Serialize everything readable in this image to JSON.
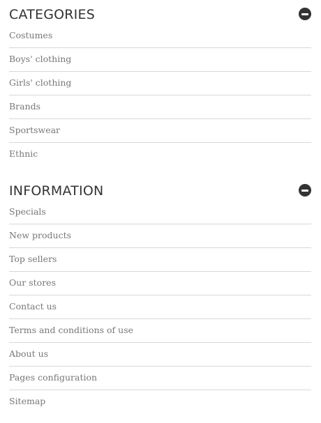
{
  "categories": {
    "title": "CATEGORIES",
    "toggle_icon": "minus-circle-icon",
    "items": [
      {
        "label": "Costumes"
      },
      {
        "label": "Boys' clothing"
      },
      {
        "label": "Girls' clothing"
      },
      {
        "label": "Brands"
      },
      {
        "label": "Sportswear"
      },
      {
        "label": "Ethnic"
      }
    ]
  },
  "information": {
    "title": "INFORMATION",
    "toggle_icon": "minus-circle-icon",
    "items": [
      {
        "label": "Specials"
      },
      {
        "label": "New products"
      },
      {
        "label": "Top sellers"
      },
      {
        "label": "Our stores"
      },
      {
        "label": "Contact us"
      },
      {
        "label": "Terms and conditions of use"
      },
      {
        "label": "About us"
      },
      {
        "label": "Pages configuration"
      },
      {
        "label": "Sitemap"
      }
    ]
  },
  "colors": {
    "title": "#333333",
    "link": "#777777",
    "divider": "#d8d8d8",
    "icon": "#333333"
  }
}
